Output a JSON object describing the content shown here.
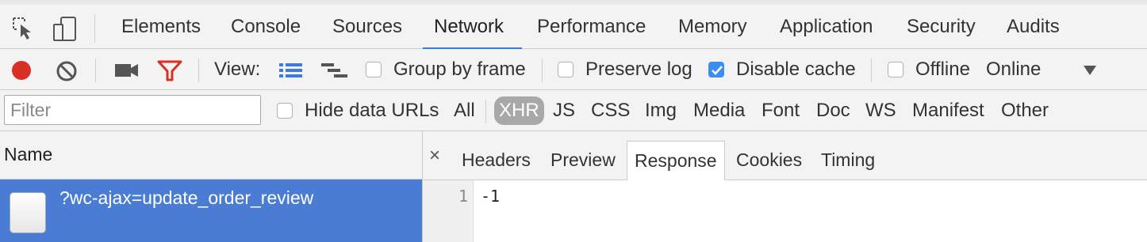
{
  "colors": {
    "accent": "#3879d9",
    "record": "#d93025",
    "filter_icon": "#d93025",
    "selected_row": "#4a7cd4",
    "checkbox_checked": "#3d8cf0",
    "chip": "#a8a8a8"
  },
  "main_tabs": [
    {
      "label": "Elements"
    },
    {
      "label": "Console"
    },
    {
      "label": "Sources"
    },
    {
      "label": "Network",
      "active": true
    },
    {
      "label": "Performance"
    },
    {
      "label": "Memory"
    },
    {
      "label": "Application"
    },
    {
      "label": "Security"
    },
    {
      "label": "Audits"
    }
  ],
  "toolbar": {
    "icons": [
      "inspect-icon",
      "device-toolbar-icon",
      "record-icon",
      "clear-icon",
      "camera-icon",
      "filter-icon",
      "large-rows-icon",
      "waterfall-icon",
      "dropdown-arrow-icon"
    ],
    "view_label": "View:",
    "group_by_frame": {
      "label": "Group by frame",
      "checked": false
    },
    "preserve_log": {
      "label": "Preserve log",
      "checked": false
    },
    "disable_cache": {
      "label": "Disable cache",
      "checked": true
    },
    "offline": {
      "label": "Offline",
      "checked": false
    },
    "throttle_value": "Online"
  },
  "filterbar": {
    "placeholder": "Filter",
    "hide_data_urls": {
      "label": "Hide data URLs",
      "checked": false
    },
    "types": [
      "All",
      "XHR",
      "JS",
      "CSS",
      "Img",
      "Media",
      "Font",
      "Doc",
      "WS",
      "Manifest",
      "Other"
    ],
    "selected_type": "XHR"
  },
  "requests": {
    "column_header": "Name",
    "rows": [
      {
        "name": "?wc-ajax=update_order_review",
        "selected": true
      }
    ]
  },
  "detail": {
    "close_glyph": "×",
    "tabs": [
      "Headers",
      "Preview",
      "Response",
      "Cookies",
      "Timing"
    ],
    "active_tab": "Response",
    "response_lines": [
      {
        "number": "1",
        "text": "-1"
      }
    ]
  }
}
